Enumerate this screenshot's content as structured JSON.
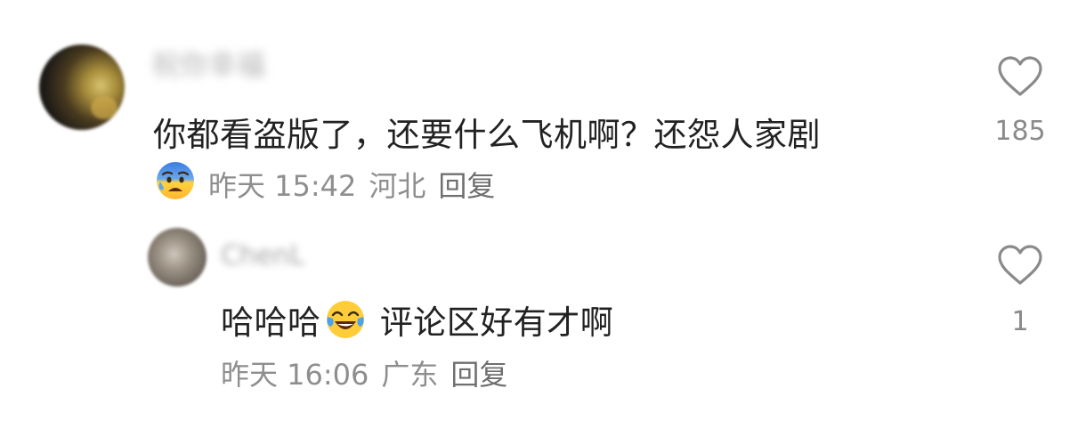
{
  "comments": [
    {
      "username": "祝你幸福",
      "text": "你都看盗版了，还要什么飞机啊？还怨人家剧",
      "reaction_emoji": "anxious-sweat-face",
      "time": "昨天 15:42",
      "location": "河北",
      "reply_label": "回复",
      "likes": "185"
    },
    {
      "username": "ChenL",
      "text_before_emoji": "哈哈哈",
      "inline_emoji": "tears-of-joy-face",
      "text_after_emoji": " 评论区好有才啊",
      "time": "昨天 16:06",
      "location": "广东",
      "reply_label": "回复",
      "likes": "1"
    }
  ],
  "colors": {
    "text": "#222222",
    "meta": "#8e8e8e",
    "icon": "#8a8a8a"
  }
}
